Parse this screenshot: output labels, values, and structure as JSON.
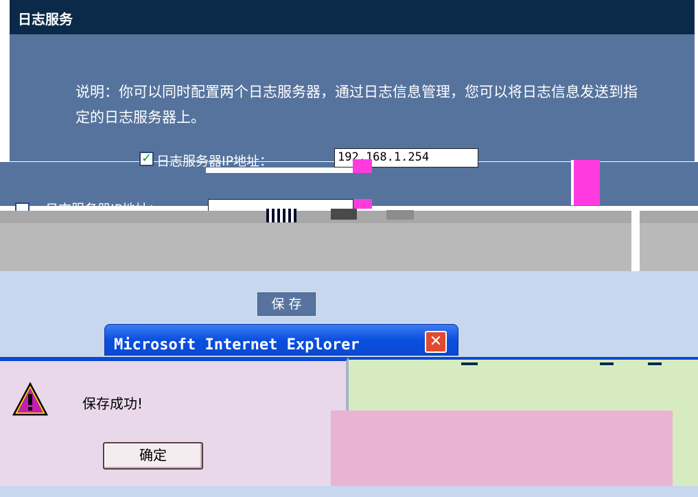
{
  "header": {
    "title": "日志服务"
  },
  "description": "说明：你可以同时配置两个日志服务器，通过日志信息管理，您可以将日志信息发送到指定的日志服务器上。",
  "server1": {
    "checked": true,
    "label": "日志服务器IP地址：",
    "ip_value": "192.168.1.254"
  },
  "server2": {
    "checked": false,
    "label": "日志服务器IP地址：",
    "ip_value": ""
  },
  "save_button": {
    "label": "保存"
  },
  "dialog": {
    "title": "Microsoft Internet Explorer",
    "message": "保存成功!",
    "ok_label": "确定",
    "icon": "warning-icon"
  },
  "colors": {
    "header_bg": "#0b2a49",
    "panel_bg": "#55739d",
    "dialog_title": "#0a4fe0",
    "dialog_body": "#e8d8ea"
  }
}
